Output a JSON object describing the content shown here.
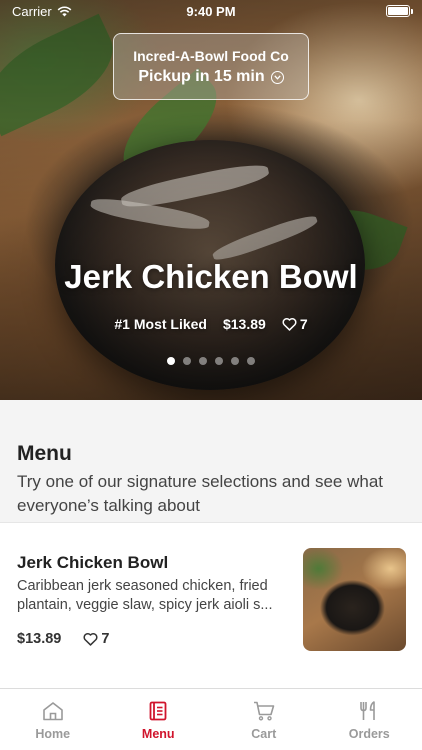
{
  "status_bar": {
    "carrier": "Carrier",
    "time": "9:40 PM"
  },
  "pickup": {
    "restaurant": "Incred-A-Bowl Food Co",
    "pickup_text": "Pickup in 15 min"
  },
  "featured": {
    "title": "Jerk Chicken Bowl",
    "badge": "#1 Most Liked",
    "price": "$13.89",
    "likes": "7",
    "slide_count": 6,
    "active_slide": 1
  },
  "menu": {
    "heading": "Menu",
    "subheading": "Try one of our signature selections and see what everyone’s talking about"
  },
  "items": [
    {
      "name": "Jerk Chicken Bowl",
      "description": "Caribbean jerk seasoned chicken, fried plantain, veggie slaw, spicy jerk aioli s...",
      "price": "$13.89",
      "likes": "7"
    }
  ],
  "tabs": [
    {
      "label": "Home",
      "icon": "home-icon"
    },
    {
      "label": "Menu",
      "icon": "menu-book-icon",
      "active": true
    },
    {
      "label": "Cart",
      "icon": "cart-icon"
    },
    {
      "label": "Orders",
      "icon": "utensils-icon"
    }
  ],
  "colors": {
    "accent": "#d0142c",
    "inactive_tab": "#9a9a9a"
  }
}
